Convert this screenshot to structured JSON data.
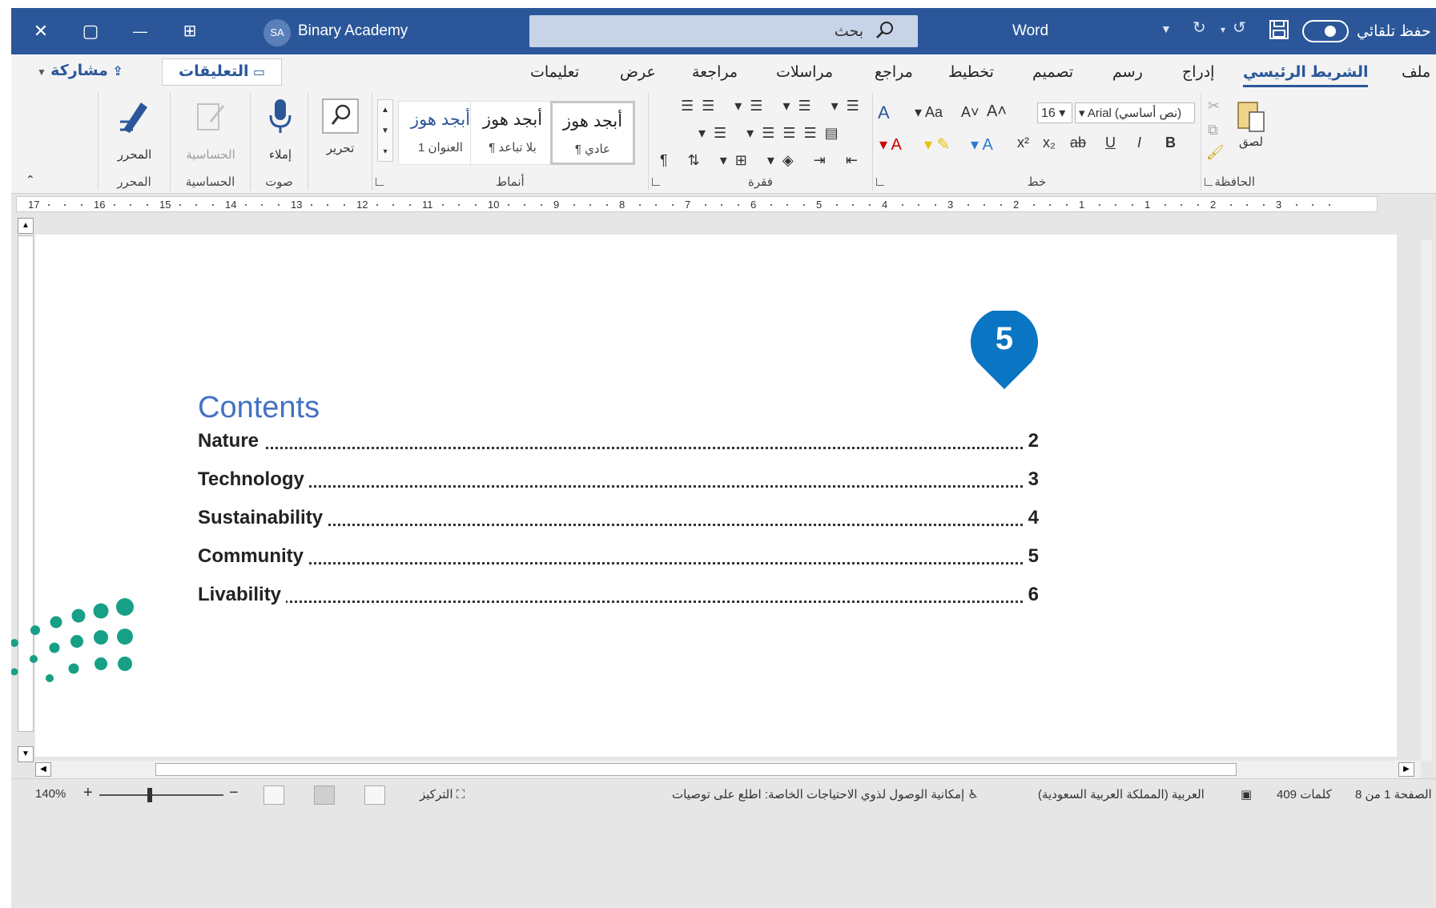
{
  "titlebar": {
    "close": "✕",
    "restore": "▢",
    "minimize": "—",
    "ribbon_display": "⊞",
    "user_initials": "SA",
    "user_name": "Binary Academy",
    "search_placeholder": "بحث",
    "app_name": "Word",
    "autosave_label": "حفظ تلقائي"
  },
  "tabs": [
    "ملف",
    "الشريط الرئيسي",
    "إدراج",
    "رسم",
    "تصميم",
    "تخطيط",
    "مراجع",
    "مراسلات",
    "مراجعة",
    "عرض",
    "تعليمات"
  ],
  "active_tab": "الشريط الرئيسي",
  "comments_label": "التعليقات",
  "share_label": "مشاركة",
  "ribbon": {
    "clipboard": {
      "label": "الحافظة",
      "paste": "لصق"
    },
    "font": {
      "label": "خط",
      "font_name": "Arial (نص أساسي)",
      "font_size": "16",
      "bold": "B",
      "italic": "I",
      "underline": "U",
      "strike": "ab",
      "subscript": "x₂",
      "superscript": "x²"
    },
    "paragraph": {
      "label": "فقرة"
    },
    "styles": {
      "label": "أنماط",
      "items": [
        {
          "sample": "أبجد هوز",
          "name": "¶ عادي"
        },
        {
          "sample": "أبجد هوز",
          "name": "¶ بلا تباعد"
        },
        {
          "sample": "أبجد هوز",
          "name": "العنوان 1"
        }
      ]
    },
    "editing": {
      "label": "تحرير"
    },
    "voice": {
      "label": "صوت",
      "dictate": "إملاء"
    },
    "sensitivity": {
      "label": "الحساسية",
      "button": "الحساسية"
    },
    "editor": {
      "label": "المحرر",
      "button": "المحرر"
    }
  },
  "ruler_numbers": [
    "17",
    "16",
    "15",
    "14",
    "13",
    "12",
    "11",
    "10",
    "9",
    "8",
    "7",
    "6",
    "5",
    "4",
    "3",
    "2",
    "1",
    "1",
    "2",
    "3"
  ],
  "document": {
    "marker_number": "5",
    "toc_title": "Contents",
    "toc": [
      {
        "title": "Nature",
        "page": "2"
      },
      {
        "title": "Technology",
        "page": "3"
      },
      {
        "title": "Sustainability",
        "page": "4"
      },
      {
        "title": "Community",
        "page": "5"
      },
      {
        "title": "Livability",
        "page": "6"
      }
    ]
  },
  "statusbar": {
    "page_info": "الصفحة 1 من 8",
    "word_count": "409 كلمات",
    "language": "العربية (المملكة العربية السعودية)",
    "accessibility": "إمكانية الوصول لذوي الاحتياجات الخاصة: اطلع على توصيات",
    "focus": "التركيز",
    "zoom": "140%"
  },
  "colors": {
    "title_bar": "#2b579a",
    "toc_title": "#4472c4",
    "marker": "#0a75c2",
    "logo_green": "#17a085"
  }
}
